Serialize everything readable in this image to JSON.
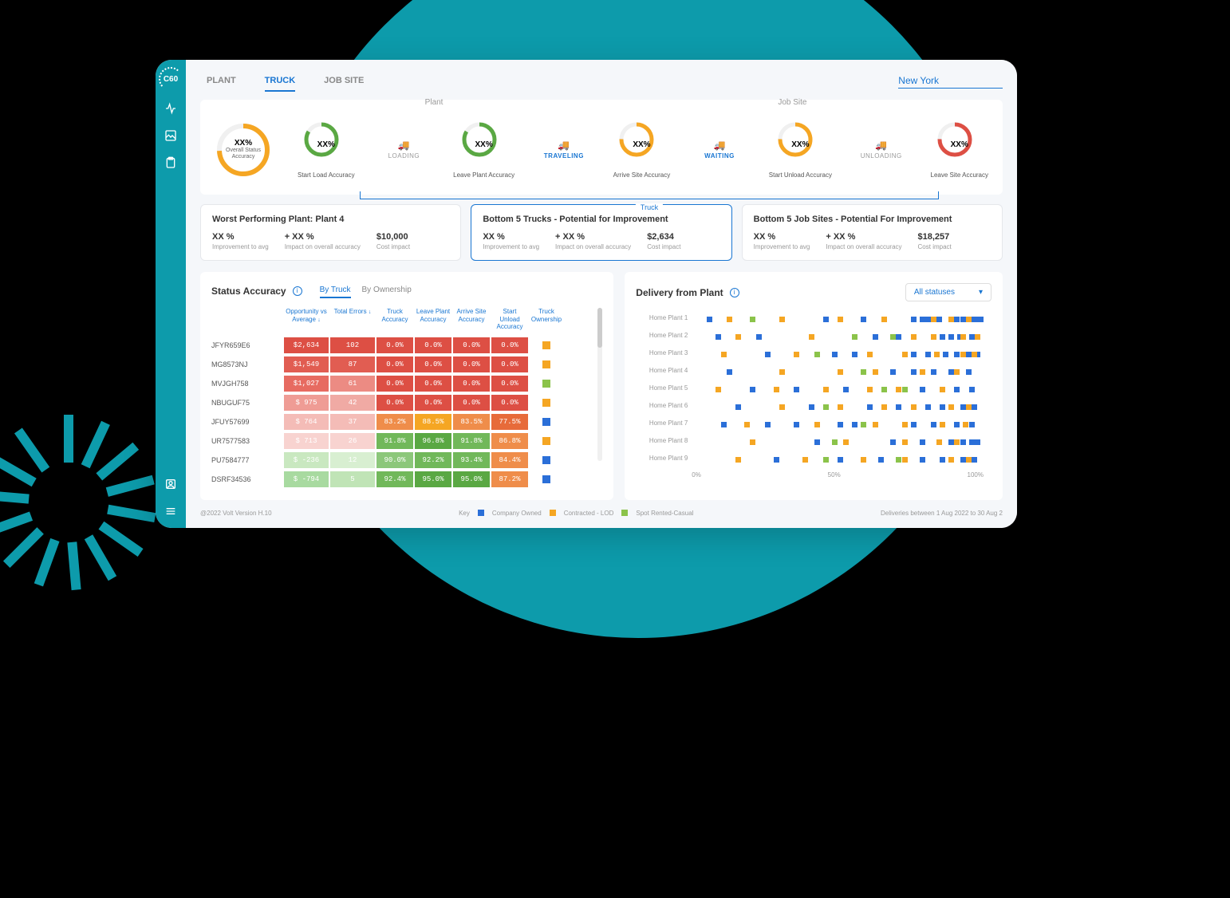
{
  "logo_text": "C60",
  "tabs": {
    "plant": "PLANT",
    "truck": "TRUCK",
    "jobsite": "JOB SITE"
  },
  "location": "New York",
  "flow": {
    "section_plant": "Plant",
    "section_jobsite": "Job Site",
    "overall": {
      "value": "XX%",
      "label": "Overall Status Accuracy"
    },
    "steps": {
      "start_load": {
        "value": "XX%",
        "label": "Start Load Accuracy"
      },
      "leave_plant": {
        "value": "XX%",
        "label": "Leave Plant Accuracy"
      },
      "arrive_site": {
        "value": "XX%",
        "label": "Arrive Site Accuracy"
      },
      "start_unload": {
        "value": "XX%",
        "label": "Start Unload Accuracy"
      },
      "leave_site": {
        "value": "XX%",
        "label": "Leave Site Accuracy"
      }
    },
    "connectors": {
      "loading": "LOADING",
      "traveling": "TRAVELING",
      "waiting": "WAITING",
      "unloading": "UNLOADING"
    },
    "truck_label": "Truck"
  },
  "kpi": {
    "worst_plant": {
      "title": "Worst Performing Plant: Plant 4",
      "s1": {
        "val": "XX %",
        "lbl": "Improvement to avg"
      },
      "s2": {
        "val": "+ XX %",
        "lbl": "Impact on overall accuracy"
      },
      "s3": {
        "val": "$10,000",
        "lbl": "Cost impact"
      }
    },
    "bottom_trucks": {
      "title": "Bottom 5 Trucks - Potential for Improvement",
      "s1": {
        "val": "XX %",
        "lbl": "Improvement to avg"
      },
      "s2": {
        "val": "+ XX %",
        "lbl": "Impact on overall accuracy"
      },
      "s3": {
        "val": "$2,634",
        "lbl": "Cost impact"
      }
    },
    "bottom_jobs": {
      "title": "Bottom 5 Job Sites - Potential For Improvement",
      "s1": {
        "val": "XX %",
        "lbl": "Improvement to avg"
      },
      "s2": {
        "val": "+ XX %",
        "lbl": "Impact on overall accuracy"
      },
      "s3": {
        "val": "$18,257",
        "lbl": "Cost impact"
      }
    }
  },
  "status_panel": {
    "title": "Status Accuracy",
    "sub_tabs": {
      "by_truck": "By Truck",
      "by_ownership": "By Ownership"
    },
    "cols": {
      "opp": "Opportunity vs Average",
      "err": "Total Errors",
      "tacc": "Truck Accuracy",
      "lpacc": "Leave Plant Accuracy",
      "asacc": "Arrive Site Accuracy",
      "suacc": "Start Unload Accuracy",
      "own": "Truck Ownership"
    },
    "rows": [
      {
        "name": "JFYR659E6",
        "opp": "$2,634",
        "opp_c": "#dd4f44",
        "err": "102",
        "err_c": "#dd4f44",
        "tacc": "0.0%",
        "tacc_c": "#dd4f44",
        "lpacc": "0.0%",
        "lpacc_c": "#dd4f44",
        "asacc": "0.0%",
        "asacc_c": "#dd4f44",
        "suacc": "0.0%",
        "suacc_c": "#dd4f44",
        "own": "#f5a623"
      },
      {
        "name": "MG8573NJ",
        "opp": "$1,549",
        "opp_c": "#e15d52",
        "err": "87",
        "err_c": "#e15d52",
        "tacc": "0.0%",
        "tacc_c": "#dd4f44",
        "lpacc": "0.0%",
        "lpacc_c": "#dd4f44",
        "asacc": "0.0%",
        "asacc_c": "#dd4f44",
        "suacc": "0.0%",
        "suacc_c": "#dd4f44",
        "own": "#f5a623"
      },
      {
        "name": "MVJGH758",
        "opp": "$1,027",
        "opp_c": "#e76b61",
        "err": "61",
        "err_c": "#ec8b83",
        "tacc": "0.0%",
        "tacc_c": "#dd4f44",
        "lpacc": "0.0%",
        "lpacc_c": "#dd4f44",
        "asacc": "0.0%",
        "asacc_c": "#dd4f44",
        "suacc": "0.0%",
        "suacc_c": "#dd4f44",
        "own": "#8bc34a"
      },
      {
        "name": "NBUGUF75",
        "opp": "$ 975",
        "opp_c": "#ef9c95",
        "err": "42",
        "err_c": "#f0aaa4",
        "tacc": "0.0%",
        "tacc_c": "#dd4f44",
        "lpacc": "0.0%",
        "lpacc_c": "#dd4f44",
        "asacc": "0.0%",
        "asacc_c": "#dd4f44",
        "suacc": "0.0%",
        "suacc_c": "#dd4f44",
        "own": "#f5a623"
      },
      {
        "name": "JFUY57699",
        "opp": "$ 764",
        "opp_c": "#f4bcb7",
        "err": "37",
        "err_c": "#f4bcb7",
        "tacc": "83.2%",
        "tacc_c": "#ef8d4a",
        "lpacc": "88.5%",
        "lpacc_c": "#f5a623",
        "asacc": "83.5%",
        "asacc_c": "#ef8d4a",
        "suacc": "77.5%",
        "suacc_c": "#e76b3a",
        "own": "#2b6fd8"
      },
      {
        "name": "UR7577583",
        "opp": "$ 713",
        "opp_c": "#f8d3d0",
        "err": "26",
        "err_c": "#f8d3d0",
        "tacc": "91.8%",
        "tacc_c": "#71b85a",
        "lpacc": "96.8%",
        "lpacc_c": "#5aa843",
        "asacc": "91.8%",
        "asacc_c": "#71b85a",
        "suacc": "86.8%",
        "suacc_c": "#ef8d4a",
        "own": "#f5a623"
      },
      {
        "name": "PU7584777",
        "opp": "$ -236",
        "opp_c": "#c9e8c0",
        "err": "12",
        "err_c": "#d8efd1",
        "tacc": "90.0%",
        "tacc_c": "#8cc77a",
        "lpacc": "92.2%",
        "lpacc_c": "#71b85a",
        "asacc": "93.4%",
        "asacc_c": "#71b85a",
        "suacc": "84.4%",
        "suacc_c": "#ef8d4a",
        "own": "#2b6fd8"
      },
      {
        "name": "DSRF34536",
        "opp": "$ -794",
        "opp_c": "#a8daa0",
        "err": "5",
        "err_c": "#c0e4b6",
        "tacc": "92.4%",
        "tacc_c": "#71b85a",
        "lpacc": "95.0%",
        "lpacc_c": "#5aa843",
        "asacc": "95.0%",
        "asacc_c": "#5aa843",
        "suacc": "87.2%",
        "suacc_c": "#ef8d4a",
        "own": "#2b6fd8"
      }
    ]
  },
  "delivery_panel": {
    "title": "Delivery from Plant",
    "select": "All statuses",
    "plants": [
      "Home Plant 1",
      "Home Plant 2",
      "Home Plant 3",
      "Home Plant 4",
      "Home Plant 5",
      "Home Plant 6",
      "Home Plant 7",
      "Home Plant 8",
      "Home Plant 9"
    ],
    "xaxis": {
      "x0": "0%",
      "x50": "50%",
      "x100": "100%"
    }
  },
  "footer": {
    "version": "@2022 Volt Version H.10",
    "key_label": "Key",
    "k1": "Company Owned",
    "k2": "Contracted - LOD",
    "k3": "Spot Rented-Casual",
    "date_range": "Deliveries between 1 Aug 2022 to 30 Aug 2"
  },
  "colors": {
    "blue": "#2b6fd8",
    "orange": "#f5a623",
    "green": "#8bc34a"
  },
  "chart_data": {
    "type": "scatter",
    "title": "Delivery from Plant",
    "xlabel": "",
    "ylabel": "",
    "xlim": [
      0,
      100
    ],
    "categories": [
      "Home Plant 1",
      "Home Plant 2",
      "Home Plant 3",
      "Home Plant 4",
      "Home Plant 5",
      "Home Plant 6",
      "Home Plant 7",
      "Home Plant 8",
      "Home Plant 9"
    ],
    "series": [
      {
        "name": "Company Owned",
        "color": "#2b6fd8",
        "points": [
          [
            5,
            0
          ],
          [
            45,
            0
          ],
          [
            58,
            0
          ],
          [
            75,
            0
          ],
          [
            78,
            0
          ],
          [
            80,
            0
          ],
          [
            84,
            0
          ],
          [
            90,
            0
          ],
          [
            92,
            0
          ],
          [
            95,
            0
          ],
          [
            97,
            0
          ],
          [
            98,
            0
          ],
          [
            8,
            1
          ],
          [
            22,
            1
          ],
          [
            62,
            1
          ],
          [
            70,
            1
          ],
          [
            85,
            1
          ],
          [
            88,
            1
          ],
          [
            91,
            1
          ],
          [
            95,
            1
          ],
          [
            25,
            2
          ],
          [
            48,
            2
          ],
          [
            55,
            2
          ],
          [
            75,
            2
          ],
          [
            80,
            2
          ],
          [
            86,
            2
          ],
          [
            90,
            2
          ],
          [
            94,
            2
          ],
          [
            97,
            2
          ],
          [
            12,
            3
          ],
          [
            68,
            3
          ],
          [
            75,
            3
          ],
          [
            82,
            3
          ],
          [
            88,
            3
          ],
          [
            94,
            3
          ],
          [
            20,
            4
          ],
          [
            35,
            4
          ],
          [
            52,
            4
          ],
          [
            78,
            4
          ],
          [
            90,
            4
          ],
          [
            95,
            4
          ],
          [
            15,
            5
          ],
          [
            40,
            5
          ],
          [
            60,
            5
          ],
          [
            70,
            5
          ],
          [
            80,
            5
          ],
          [
            85,
            5
          ],
          [
            92,
            5
          ],
          [
            96,
            5
          ],
          [
            10,
            6
          ],
          [
            25,
            6
          ],
          [
            35,
            6
          ],
          [
            50,
            6
          ],
          [
            55,
            6
          ],
          [
            75,
            6
          ],
          [
            82,
            6
          ],
          [
            90,
            6
          ],
          [
            95,
            6
          ],
          [
            42,
            7
          ],
          [
            68,
            7
          ],
          [
            78,
            7
          ],
          [
            88,
            7
          ],
          [
            92,
            7
          ],
          [
            95,
            7
          ],
          [
            97,
            7
          ],
          [
            28,
            8
          ],
          [
            50,
            8
          ],
          [
            64,
            8
          ],
          [
            78,
            8
          ],
          [
            85,
            8
          ],
          [
            92,
            8
          ],
          [
            96,
            8
          ]
        ]
      },
      {
        "name": "Contracted - LOD",
        "color": "#f5a623",
        "points": [
          [
            12,
            0
          ],
          [
            30,
            0
          ],
          [
            50,
            0
          ],
          [
            65,
            0
          ],
          [
            82,
            0
          ],
          [
            88,
            0
          ],
          [
            94,
            0
          ],
          [
            15,
            1
          ],
          [
            40,
            1
          ],
          [
            55,
            1
          ],
          [
            75,
            1
          ],
          [
            82,
            1
          ],
          [
            92,
            1
          ],
          [
            97,
            1
          ],
          [
            10,
            2
          ],
          [
            35,
            2
          ],
          [
            60,
            2
          ],
          [
            72,
            2
          ],
          [
            83,
            2
          ],
          [
            92,
            2
          ],
          [
            96,
            2
          ],
          [
            30,
            3
          ],
          [
            50,
            3
          ],
          [
            62,
            3
          ],
          [
            78,
            3
          ],
          [
            90,
            3
          ],
          [
            8,
            4
          ],
          [
            28,
            4
          ],
          [
            45,
            4
          ],
          [
            60,
            4
          ],
          [
            70,
            4
          ],
          [
            85,
            4
          ],
          [
            30,
            5
          ],
          [
            50,
            5
          ],
          [
            65,
            5
          ],
          [
            75,
            5
          ],
          [
            88,
            5
          ],
          [
            94,
            5
          ],
          [
            18,
            6
          ],
          [
            42,
            6
          ],
          [
            62,
            6
          ],
          [
            72,
            6
          ],
          [
            85,
            6
          ],
          [
            93,
            6
          ],
          [
            20,
            7
          ],
          [
            52,
            7
          ],
          [
            72,
            7
          ],
          [
            84,
            7
          ],
          [
            90,
            7
          ],
          [
            15,
            8
          ],
          [
            38,
            8
          ],
          [
            58,
            8
          ],
          [
            72,
            8
          ],
          [
            88,
            8
          ],
          [
            94,
            8
          ]
        ]
      },
      {
        "name": "Spot Rented-Casual",
        "color": "#8bc34a",
        "points": [
          [
            20,
            0
          ],
          [
            55,
            1
          ],
          [
            68,
            1
          ],
          [
            42,
            2
          ],
          [
            58,
            3
          ],
          [
            65,
            4
          ],
          [
            72,
            4
          ],
          [
            45,
            5
          ],
          [
            58,
            6
          ],
          [
            48,
            7
          ],
          [
            45,
            8
          ],
          [
            70,
            8
          ]
        ]
      }
    ]
  }
}
